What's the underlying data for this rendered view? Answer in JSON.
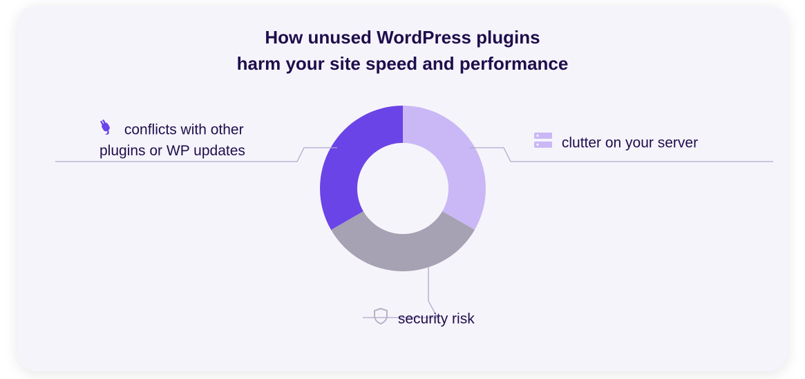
{
  "title_line1": "How unused WordPress plugins",
  "title_line2": "harm your site speed and performance",
  "labels": {
    "clutter": "clutter on your server",
    "conflicts_line1": "conflicts with other",
    "conflicts_line2": "plugins or WP updates",
    "security": "security risk"
  },
  "colors": {
    "slice_conflicts": "#6a44e6",
    "slice_clutter": "#c9b8f5",
    "slice_security": "#a6a1b3",
    "title_text": "#1e0e4b",
    "connector": "#b0a8c9",
    "card_bg": "#f6f4fb"
  },
  "chart_data": {
    "type": "pie",
    "title": "How unused WordPress plugins harm your site speed and performance",
    "categories": [
      "clutter on your server",
      "security risk",
      "conflicts with other plugins or WP updates"
    ],
    "values": [
      33.3,
      33.3,
      33.3
    ],
    "series": [
      {
        "name": "clutter on your server",
        "value": 33.3,
        "color": "#c9b8f5"
      },
      {
        "name": "security risk",
        "value": 33.3,
        "color": "#a6a1b3"
      },
      {
        "name": "conflicts with other plugins or WP updates",
        "value": 33.3,
        "color": "#6a44e6"
      }
    ],
    "donut": true,
    "legend_position": "outside-callout"
  }
}
